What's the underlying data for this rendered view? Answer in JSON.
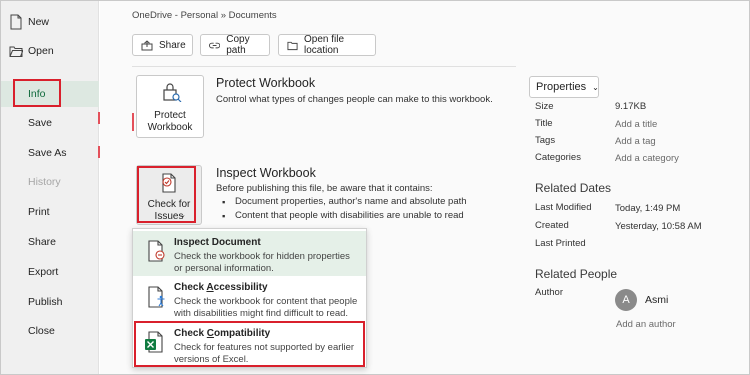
{
  "sidebar": {
    "items": [
      {
        "label": "New",
        "icon": "new-document-icon"
      },
      {
        "label": "Open",
        "icon": "open-folder-icon"
      },
      {
        "label": "Info"
      },
      {
        "label": "Save"
      },
      {
        "label": "Save As"
      },
      {
        "label": "History"
      },
      {
        "label": "Print"
      },
      {
        "label": "Share"
      },
      {
        "label": "Export"
      },
      {
        "label": "Publish"
      },
      {
        "label": "Close"
      }
    ]
  },
  "header": {
    "breadcrumb": "OneDrive - Personal » Documents",
    "actions": {
      "share": "Share",
      "copy_path": "Copy path",
      "open_location": "Open file location"
    }
  },
  "protect": {
    "button_line1": "Protect",
    "button_line2": "Workbook",
    "title": "Protect Workbook",
    "description": "Control what types of changes people can make to this workbook."
  },
  "inspect": {
    "button_line1": "Check for",
    "button_line2": "Issues",
    "title": "Inspect Workbook",
    "intro": "Before publishing this file, be aware that it contains:",
    "bullets": [
      "Document properties, author's name and absolute path",
      "Content that people with disabilities are unable to read"
    ]
  },
  "check_menu": {
    "items": [
      {
        "title": "Inspect Document",
        "desc1": "Check the workbook for hidden properties",
        "desc2": "or personal information."
      },
      {
        "title": "Check Accessibility",
        "desc1": "Check the workbook for content that people",
        "desc2": "with disabilities might find difficult to read."
      },
      {
        "title": "Check Compatibility",
        "desc1": "Check for features not supported by earlier",
        "desc2": "versions of Excel."
      }
    ]
  },
  "properties": {
    "button": "Properties",
    "rows": [
      {
        "label": "Size",
        "value": "9.17KB"
      },
      {
        "label": "Title",
        "value": "Add a title"
      },
      {
        "label": "Tags",
        "value": "Add a tag"
      },
      {
        "label": "Categories",
        "value": "Add a category"
      }
    ]
  },
  "related_dates": {
    "heading": "Related Dates",
    "rows": [
      {
        "label": "Last Modified",
        "value": "Today, 1:49 PM"
      },
      {
        "label": "Created",
        "value": "Yesterday, 10:58 AM"
      },
      {
        "label": "Last Printed",
        "value": ""
      }
    ]
  },
  "related_people": {
    "heading": "Related People",
    "author_label": "Author",
    "author_initial": "A",
    "author_name": "Asmi",
    "add_author": "Add an author"
  },
  "colors": {
    "accent_green": "#0f6a3c",
    "highlight_red": "#d9202c",
    "excel_green": "#107c41"
  }
}
